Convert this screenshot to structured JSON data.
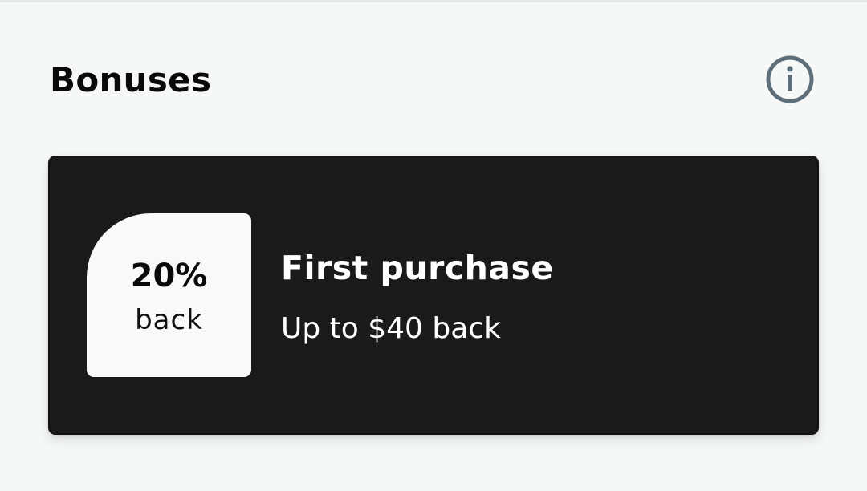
{
  "header": {
    "title": "Bonuses",
    "info_icon": "info-circle-icon"
  },
  "bonus_card": {
    "badge": {
      "percent": "20%",
      "label": "back"
    },
    "title": "First purchase",
    "subtitle": "Up to $40 back"
  },
  "colors": {
    "background": "#f6f8f8",
    "card_background": "#1a1a1a",
    "badge_background": "#f9f9f9",
    "icon": "#5f6f79"
  }
}
